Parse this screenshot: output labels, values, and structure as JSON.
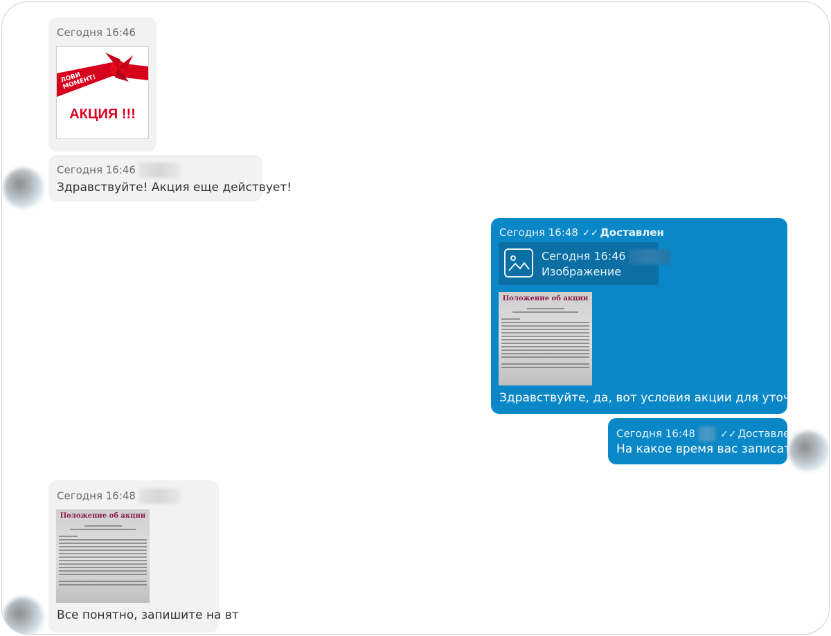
{
  "messages": [
    {
      "time": "Сегодня 16:46"
    },
    {
      "time": "Сегодня 16:46",
      "text": "Здравствуйте! Акция еще действует!"
    },
    {
      "time": "Сегодня 16:48",
      "status": "Доставлен",
      "quote": {
        "time": "Сегодня 16:46",
        "label": "Изображение"
      },
      "doc_title": "Положение об акции",
      "text": "Здравствуйте, да, вот условия акции для уточнения."
    },
    {
      "time": "Сегодня 16:48",
      "status": "Доставлен",
      "text": "На какое время вас записать?"
    },
    {
      "time": "Сегодня 16:48",
      "doc_title": "Положение об акции",
      "text": "Все понятно, запишите на вт"
    }
  ],
  "promo": {
    "ribbon": "ЛОВИ МОМЕНТ!",
    "title": "АКЦИЯ !!!"
  },
  "icons": {
    "read": "double-check-icon",
    "image": "image-placeholder-icon"
  },
  "colors": {
    "incoming": "#f2f2f2",
    "outgoing": "#0a87c6",
    "accent": "#d6001c"
  }
}
